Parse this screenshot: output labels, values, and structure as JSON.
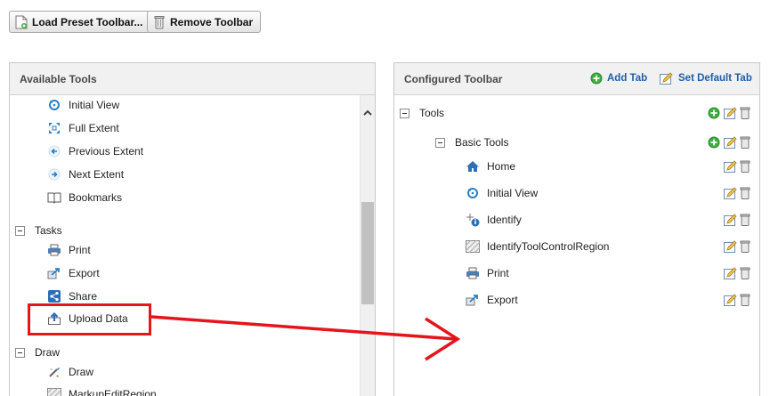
{
  "top_buttons": {
    "load_preset": "Load Preset Toolbar...",
    "remove_toolbar": "Remove Toolbar"
  },
  "available_tools": {
    "title": "Available Tools",
    "items": [
      {
        "label": "Initial View",
        "icon": "initial-view-icon"
      },
      {
        "label": "Full Extent",
        "icon": "full-extent-icon"
      },
      {
        "label": "Previous Extent",
        "icon": "previous-extent-icon"
      },
      {
        "label": "Next Extent",
        "icon": "next-extent-icon"
      },
      {
        "label": "Bookmarks",
        "icon": "bookmarks-icon"
      }
    ],
    "tasks_group": "Tasks",
    "tasks": [
      {
        "label": "Print",
        "icon": "print-icon"
      },
      {
        "label": "Export",
        "icon": "export-icon"
      },
      {
        "label": "Share",
        "icon": "share-icon"
      },
      {
        "label": "Upload Data",
        "icon": "upload-icon"
      }
    ],
    "draw_group": "Draw",
    "draw": [
      {
        "label": "Draw",
        "icon": "draw-icon"
      },
      {
        "label": "MarkupEditRegion",
        "icon": "region-icon"
      }
    ]
  },
  "configured_toolbar": {
    "title": "Configured Toolbar",
    "add_tab": "Add Tab",
    "set_default_tab": "Set Default Tab",
    "tab": "Tools",
    "group": "Basic Tools",
    "tools": [
      {
        "label": "Home",
        "icon": "home-icon"
      },
      {
        "label": "Initial View",
        "icon": "initial-view-icon"
      },
      {
        "label": "Identify",
        "icon": "identify-icon"
      },
      {
        "label": "IdentifyToolControlRegion",
        "icon": "region-icon"
      },
      {
        "label": "Print",
        "icon": "print-icon"
      },
      {
        "label": "Export",
        "icon": "export-icon"
      }
    ]
  },
  "colors": {
    "link_blue": "#1f5fa8",
    "annotation_red": "#e5151b",
    "add_green": "#3fae3f"
  }
}
